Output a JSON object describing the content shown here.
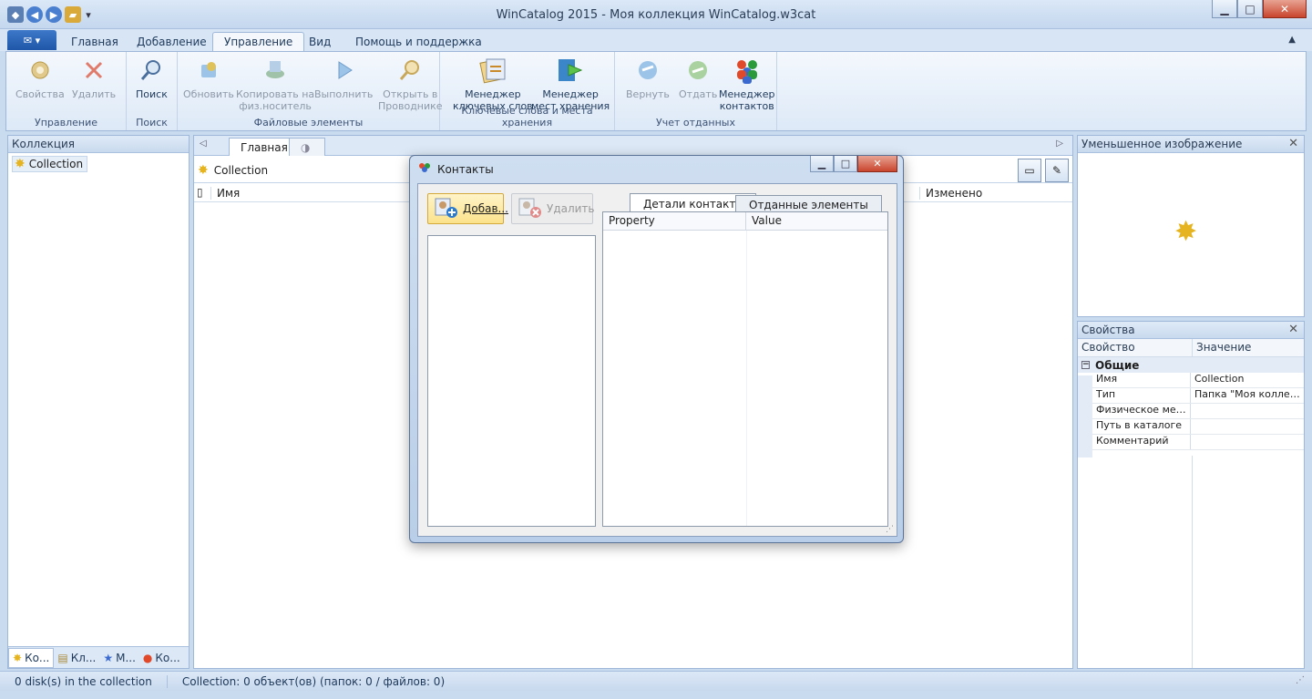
{
  "window": {
    "title": "WinCatalog 2015 - Моя коллекция WinCatalog.w3cat",
    "minimize": "▁",
    "maximize": "□",
    "close": "✕"
  },
  "ribbon": {
    "app_button": "▾",
    "tabs": [
      "Главная",
      "Добавление",
      "Управление",
      "Вид",
      "Помощь и поддержка"
    ],
    "active_tab": "Управление",
    "groups": {
      "manage": {
        "label": "Управление",
        "buttons": [
          "Свойства",
          "Удалить"
        ]
      },
      "search": {
        "label": "Поиск",
        "buttons": [
          "Поиск"
        ]
      },
      "files": {
        "label": "Файловые элементы",
        "buttons": [
          "Обновить",
          "Копировать на физ.носитель",
          "Выполнить",
          "Открыть в Проводнике"
        ]
      },
      "keywords": {
        "label": "Ключевые слова и места хранения",
        "buttons": [
          "Менеджер ключевых слов",
          "Менеджер мест хранения"
        ]
      },
      "loans": {
        "label": "Учет отданных",
        "buttons": [
          "Вернуть",
          "Отдать",
          "Менеджер контактов"
        ]
      }
    },
    "btn_lines": {
      "svoystva": "Свойства",
      "udalit": "Удалить",
      "poisk": "Поиск",
      "obnovit": "Обновить",
      "kopir1": "Копировать на",
      "kopir2": "физ.носитель",
      "vypolnit": "Выполнить",
      "otkryt1": "Открыть в",
      "otkryt2": "Проводнике",
      "kw1": "Менеджер",
      "kw2": "ключевых слов",
      "ms1": "Менеджер",
      "ms2": "мест хранения",
      "vernut": "Вернуть",
      "otdat": "Отдать",
      "kt1": "Менеджер",
      "kt2": "контактов"
    }
  },
  "left_panel": {
    "title": "Коллекция",
    "tree_item": "Collection",
    "bottom_tabs": [
      "Ко...",
      "Кл...",
      "М...",
      "Ко..."
    ]
  },
  "center": {
    "doc_tab": "Главная",
    "breadcrumb": "Collection",
    "columns": {
      "name": "Имя",
      "modified": "Изменено"
    }
  },
  "thumbnail_panel": {
    "title": "Уменьшенное изображение"
  },
  "properties_panel": {
    "title": "Свойства",
    "col_property": "Свойство",
    "col_value": "Значение",
    "group": "Общие",
    "rows": [
      {
        "key": "Имя",
        "value": "Collection"
      },
      {
        "key": "Тип",
        "value": "Папка \"Моя коллекц..."
      },
      {
        "key": "Физическое мес...",
        "value": ""
      },
      {
        "key": "Путь в каталоге",
        "value": ""
      },
      {
        "key": "Комментарий",
        "value": ""
      }
    ]
  },
  "status": {
    "disks": "0 disk(s) in the collection",
    "summary": "Collection: 0 объект(ов) (папок: 0 / файлов: 0)"
  },
  "dialog": {
    "title": "Контакты",
    "add_button": "Добав...",
    "delete_button": "Удалить",
    "tabs": [
      "Детали контакта",
      "Отданные элементы"
    ],
    "grid_columns": [
      "Property",
      "Value"
    ]
  },
  "colors": {
    "accent": "#1f56a8",
    "ribbon_bg": "#dde9f7",
    "close_red": "#c9452d",
    "highlight": "#fbe28b"
  }
}
